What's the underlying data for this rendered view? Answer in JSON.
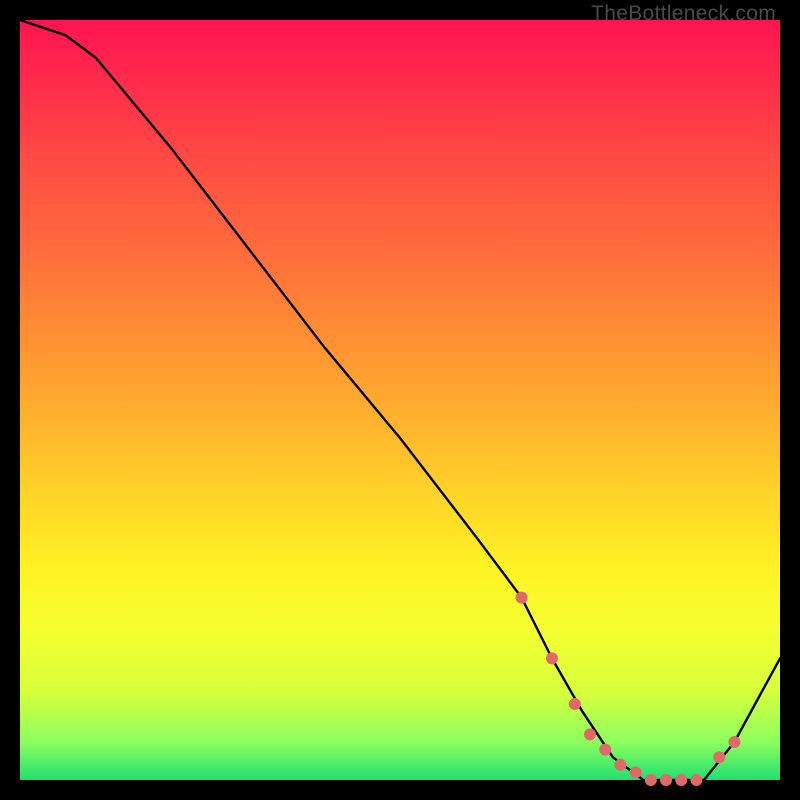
{
  "watermark": "TheBottleneck.com",
  "chart_data": {
    "type": "line",
    "title": "",
    "xlabel": "",
    "ylabel": "",
    "xlim": [
      0,
      100
    ],
    "ylim": [
      0,
      100
    ],
    "x": [
      0,
      6,
      10,
      20,
      30,
      40,
      50,
      60,
      66,
      70,
      74,
      78,
      82,
      86,
      90,
      94,
      100
    ],
    "values": [
      100,
      98,
      95,
      83,
      70,
      57,
      45,
      32,
      24,
      16,
      9,
      3,
      0,
      0,
      0,
      5,
      16
    ],
    "marker_points": {
      "x": [
        66,
        70,
        73,
        75,
        77,
        79,
        81,
        83,
        85,
        87,
        89,
        92,
        94
      ],
      "values": [
        24,
        16,
        10,
        6,
        4,
        2,
        1,
        0,
        0,
        0,
        0,
        3,
        5
      ]
    },
    "line_color": "#000000",
    "marker_color": "#e06a6a",
    "gradient_bg": true
  }
}
